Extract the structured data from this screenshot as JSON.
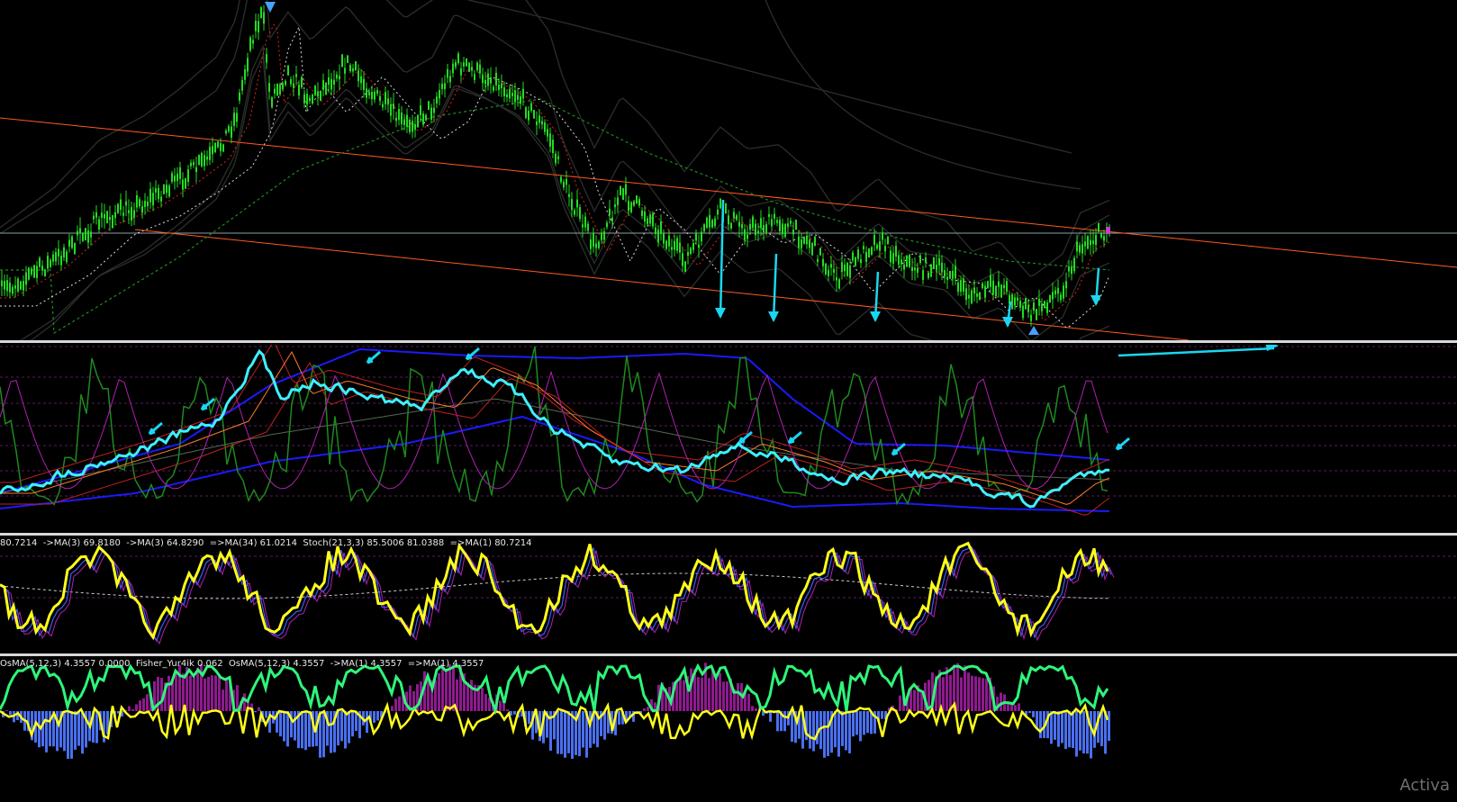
{
  "colors": {
    "background": "#000000",
    "separator": "#d8d8d8",
    "candle": "#22dd22",
    "trendline": "#ff5a1f",
    "horizontal_line": "#8a9ea6",
    "arrow": "#19d7f0",
    "rsi_main": "#3ef0ff",
    "stoch_main": "#ffff1a",
    "fisher_line": "#2ef57a",
    "histogram_pos": "#8e1a8e",
    "histogram_neg": "#4a6ff0"
  },
  "panes": {
    "stochastic": {
      "label": "80.7214  ->MA(3) 69.8180  ->MA(3) 64.8290  =>MA(34) 61.0214  Stoch(21,3,3) 85.5006 81.0388  =>MA(1) 80.7214"
    },
    "osma": {
      "label": "OsMA(5,12,3) 4.3557 0.0000  Fisher_Yur4ik 0.062  OsMA(5,12,3) 4.3557  ->MA(1) 4.3557  =>MA(1) 4.3557"
    }
  },
  "icons": {
    "down_arrow": "down-arrow-icon",
    "up_arrow": "up-arrow-icon",
    "marker_arrow": "marker-arrow-icon"
  },
  "watermark": "Activa"
}
